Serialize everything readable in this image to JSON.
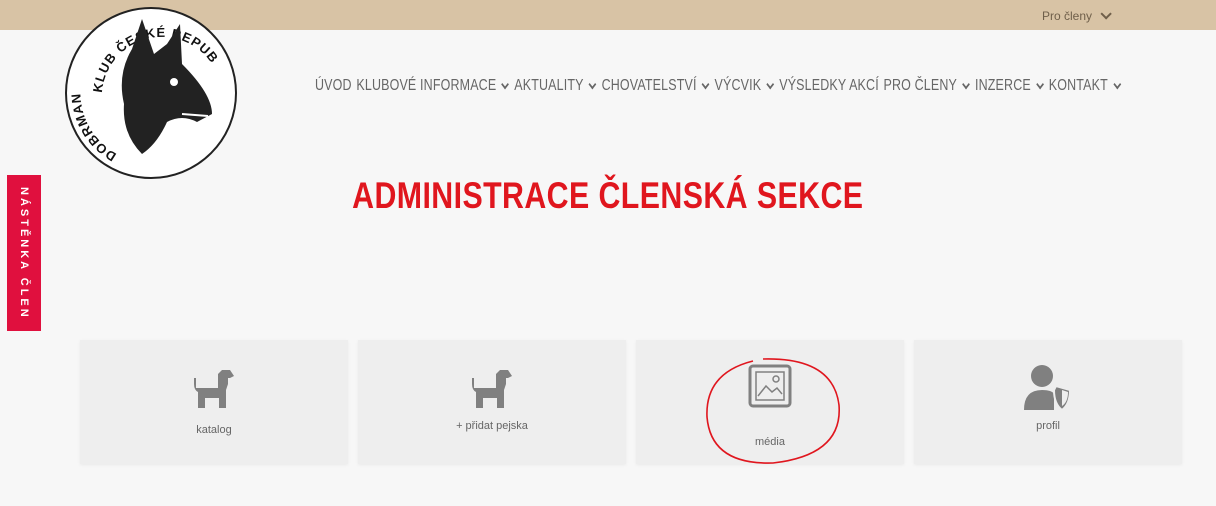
{
  "topbar": {
    "menu_label": "Pro členy"
  },
  "logo": {
    "text_top": "KLUB ČESKÉ REPUBLIKY",
    "text_left": "DOBRMAN"
  },
  "nav": {
    "items": [
      {
        "label": "ÚVOD",
        "has_dropdown": false
      },
      {
        "label": "KLUBOVÉ INFORMACE",
        "has_dropdown": true
      },
      {
        "label": "AKTUALITY",
        "has_dropdown": true
      },
      {
        "label": "CHOVATELSTVÍ",
        "has_dropdown": true
      },
      {
        "label": "VÝCVIK",
        "has_dropdown": true
      },
      {
        "label": "VÝSLEDKY AKCÍ",
        "has_dropdown": false
      },
      {
        "label": "PRO ČLENY",
        "has_dropdown": true
      },
      {
        "label": "INZERCE",
        "has_dropdown": true
      },
      {
        "label": "KONTAKT",
        "has_dropdown": true
      }
    ]
  },
  "page": {
    "title": "ADMINISTRACE ČLENSKÁ SEKCE"
  },
  "side_tab": {
    "label": "NÁSTĚNKA ČLEN"
  },
  "cards": [
    {
      "label": "katalog",
      "icon": "dog-icon"
    },
    {
      "label": "+ přidat pejska",
      "icon": "dog-icon"
    },
    {
      "label": "média",
      "icon": "image-icon"
    },
    {
      "label": "profil",
      "icon": "user-shield-icon"
    }
  ],
  "colors": {
    "accent": "#e0161e",
    "topbar": "#d8c3a5",
    "side_tab": "#e0103e",
    "annotation": "#e0161e"
  }
}
